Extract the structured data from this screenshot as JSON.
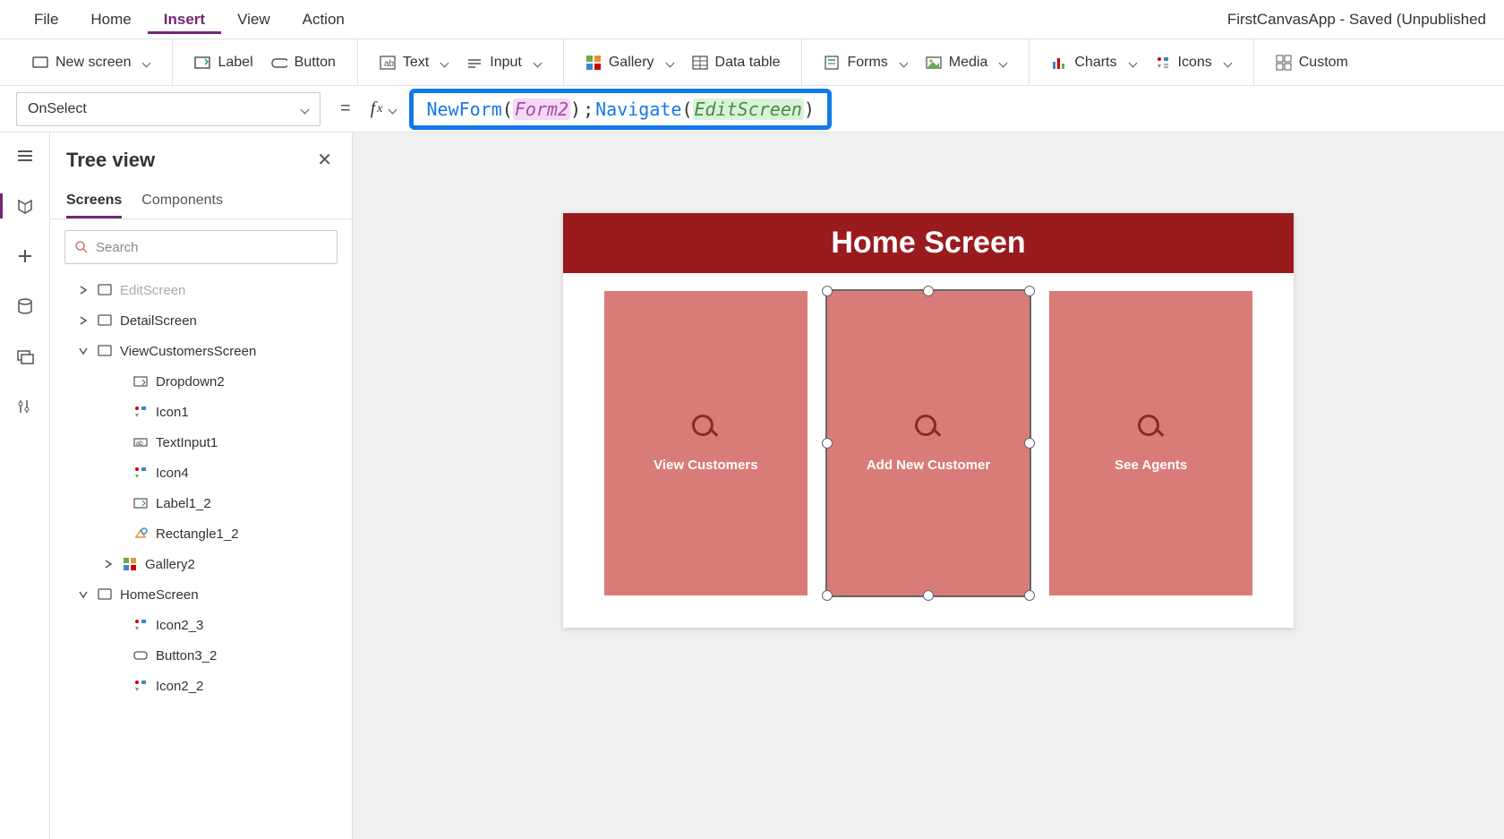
{
  "menubar": {
    "items": [
      "File",
      "Home",
      "Insert",
      "View",
      "Action"
    ],
    "active_index": 2,
    "app_title": "FirstCanvasApp - Saved (Unpublished"
  },
  "ribbon": {
    "new_screen": "New screen",
    "label": "Label",
    "button": "Button",
    "text": "Text",
    "input": "Input",
    "gallery": "Gallery",
    "data_table": "Data table",
    "forms": "Forms",
    "media": "Media",
    "charts": "Charts",
    "icons": "Icons",
    "custom": "Custom"
  },
  "formulabar": {
    "property": "OnSelect",
    "formula_tokens": {
      "kw1": "NewForm",
      "lpar1": "(",
      "arg1": "Form2",
      "rpar1": ")",
      "sep": ";",
      "kw2": "Navigate",
      "lpar2": "(",
      "arg2": "EditScreen",
      "rpar2": ")"
    }
  },
  "tree": {
    "title": "Tree view",
    "tabs": [
      "Screens",
      "Components"
    ],
    "active_tab": 0,
    "search_placeholder": "Search",
    "nodes": [
      {
        "label": "EditScreen",
        "depth": 1,
        "toggle": ">",
        "icon": "screen",
        "cut": true
      },
      {
        "label": "DetailScreen",
        "depth": 1,
        "toggle": ">",
        "icon": "screen"
      },
      {
        "label": "ViewCustomersScreen",
        "depth": 1,
        "toggle": "v",
        "icon": "screen"
      },
      {
        "label": "Dropdown2",
        "depth": 2,
        "toggle": "",
        "icon": "dropdown"
      },
      {
        "label": "Icon1",
        "depth": 2,
        "toggle": "",
        "icon": "icon"
      },
      {
        "label": "TextInput1",
        "depth": 2,
        "toggle": "",
        "icon": "textinput"
      },
      {
        "label": "Icon4",
        "depth": 2,
        "toggle": "",
        "icon": "icon"
      },
      {
        "label": "Label1_2",
        "depth": 2,
        "toggle": "",
        "icon": "label"
      },
      {
        "label": "Rectangle1_2",
        "depth": 2,
        "toggle": "",
        "icon": "rect"
      },
      {
        "label": "Gallery2",
        "depth": 2,
        "toggle": ">",
        "icon": "gallery",
        "indent": "2b"
      },
      {
        "label": "HomeScreen",
        "depth": 1,
        "toggle": "v",
        "icon": "screen"
      },
      {
        "label": "Icon2_3",
        "depth": 2,
        "toggle": "",
        "icon": "icon"
      },
      {
        "label": "Button3_2",
        "depth": 2,
        "toggle": "",
        "icon": "button"
      },
      {
        "label": "Icon2_2",
        "depth": 2,
        "toggle": "",
        "icon": "icon"
      }
    ]
  },
  "canvas": {
    "header": "Home Screen",
    "tiles": [
      {
        "label": "View Customers",
        "selected": false
      },
      {
        "label": "Add New Customer",
        "selected": true
      },
      {
        "label": "See Agents",
        "selected": false
      }
    ]
  }
}
